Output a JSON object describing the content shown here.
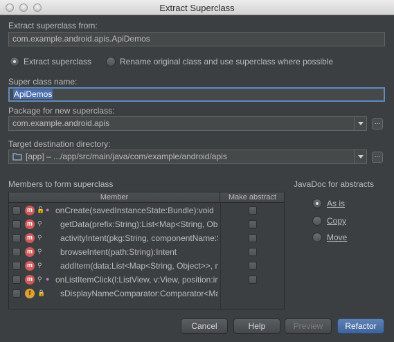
{
  "window": {
    "title": "Extract Superclass"
  },
  "extract_from": {
    "label": "Extract superclass from:",
    "value": "com.example.android.apis.ApiDemos"
  },
  "mode": {
    "options": [
      {
        "label": "Extract superclass",
        "selected": true
      },
      {
        "label": "Rename original class and use superclass where possible",
        "selected": false
      }
    ]
  },
  "super_class_name": {
    "label": "Super class name:",
    "value": "ApiDemos"
  },
  "package": {
    "label": "Package for new superclass:",
    "value": "com.example.android.apis",
    "browse": "..."
  },
  "target_dir": {
    "label": "Target destination directory:",
    "value": "[app] – .../app/src/main/java/com/example/android/apis",
    "browse": "..."
  },
  "members": {
    "label": "Members to form superclass",
    "columns": [
      "Member",
      "Make abstract"
    ],
    "rows": [
      {
        "signature": "onCreate(savedInstanceState:Bundle):void",
        "kind": "m",
        "has_abstract": true
      },
      {
        "signature": "getData(prefix:String):List<Map<String, Ob",
        "kind": "m",
        "has_abstract": true
      },
      {
        "signature": "activityIntent(pkg:String, componentName:S",
        "kind": "m",
        "has_abstract": true
      },
      {
        "signature": "browseIntent(path:String):Intent",
        "kind": "m",
        "has_abstract": true
      },
      {
        "signature": "addItem(data:List<Map<String, Object>>, n",
        "kind": "m",
        "has_abstract": true
      },
      {
        "signature": "onListItemClick(l:ListView, v:View, position:in",
        "kind": "m",
        "has_abstract": true
      },
      {
        "signature": "sDisplayNameComparator:Comparator<Ma",
        "kind": "f",
        "has_abstract": false
      }
    ]
  },
  "javadoc": {
    "label": "JavaDoc for abstracts",
    "options": [
      {
        "label": "As is",
        "selected": true
      },
      {
        "label": "Copy",
        "selected": false
      },
      {
        "label": "Move",
        "selected": false
      }
    ]
  },
  "buttons": {
    "cancel": "Cancel",
    "help": "Help",
    "preview": "Preview",
    "refactor": "Refactor"
  }
}
